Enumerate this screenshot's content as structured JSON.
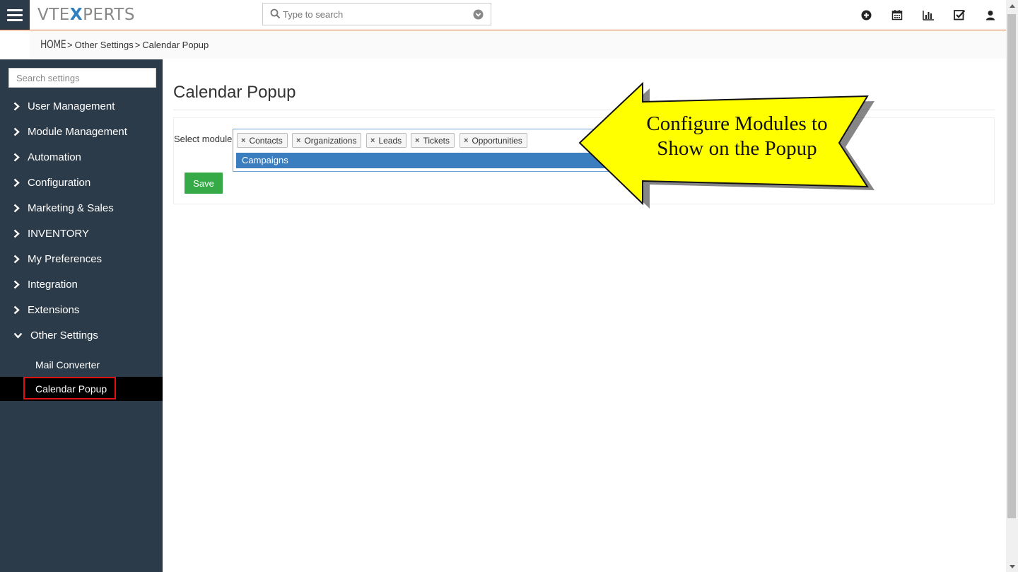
{
  "header": {
    "logo_prefix": "VTE",
    "logo_accent": "X",
    "logo_suffix": "PERTS",
    "search_placeholder": "Type to search",
    "icons": [
      "plus-circle-icon",
      "calendar-icon",
      "bar-chart-icon",
      "checkbox-icon",
      "user-icon"
    ]
  },
  "breadcrumb": {
    "home": "HOME",
    "sep": ">",
    "items": [
      "Other Settings",
      "Calendar Popup"
    ]
  },
  "sidebar": {
    "search_placeholder": "Search settings",
    "items": [
      {
        "label": "User Management"
      },
      {
        "label": "Module Management"
      },
      {
        "label": "Automation"
      },
      {
        "label": "Configuration"
      },
      {
        "label": "Marketing & Sales"
      },
      {
        "label": "INVENTORY"
      },
      {
        "label": "My Preferences"
      },
      {
        "label": "Integration"
      },
      {
        "label": "Extensions"
      },
      {
        "label": "Other Settings"
      }
    ],
    "subitems": [
      {
        "label": "Mail Converter"
      },
      {
        "label": "Calendar Popup"
      }
    ]
  },
  "main": {
    "title": "Calendar Popup",
    "select_label": "Select module",
    "chips": [
      "Contacts",
      "Organizations",
      "Leads",
      "Tickets",
      "Opportunities"
    ],
    "chip_remove": "×",
    "dropdown_option": "Campaigns",
    "save_label": "Save"
  },
  "callout": {
    "line1": "Configure Modules to",
    "line2": "Show on  the Popup"
  },
  "colors": {
    "sidebar_bg": "#2c3b49",
    "accent_line": "#e8732f",
    "logo_accent": "#2f7fc1",
    "save_green": "#35aa47",
    "highlight_blue": "#3a7ebf",
    "callout_yellow": "#ffff00",
    "annotation_red": "#e01010"
  }
}
